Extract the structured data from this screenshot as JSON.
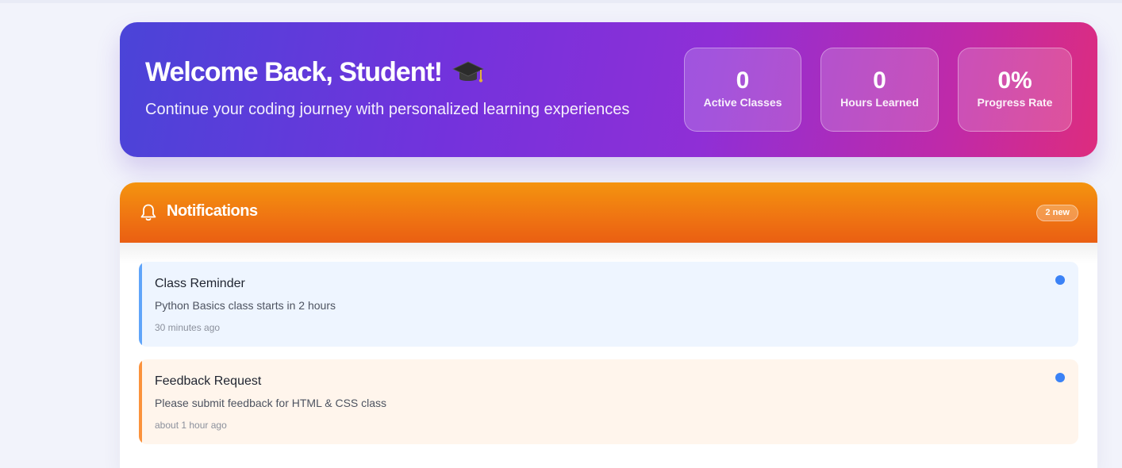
{
  "hero": {
    "title": "Welcome Back, Student!",
    "title_icon": "graduation-cap-icon",
    "subtitle": "Continue your coding journey with personalized learning experiences",
    "stats": [
      {
        "value": "0",
        "label": "Active Classes"
      },
      {
        "value": "0",
        "label": "Hours Learned"
      },
      {
        "value": "0%",
        "label": "Progress Rate"
      }
    ]
  },
  "notifications": {
    "icon": "bell-icon",
    "title": "Notifications",
    "badge": "2 new",
    "items": [
      {
        "title": "Class Reminder",
        "message": "Python Basics class starts in 2 hours",
        "time": "30 minutes ago",
        "accent": "#60a5fa",
        "background": "#eef5ff",
        "unread": true
      },
      {
        "title": "Feedback Request",
        "message": "Please submit feedback for HTML & CSS class",
        "time": "about 1 hour ago",
        "accent": "#fb923c",
        "background": "#fff5ec",
        "unread": true
      }
    ]
  },
  "colors": {
    "hero_gradient_start": "#4a44d8",
    "hero_gradient_end": "#dd2c7e",
    "notifications_header": "#f4940f",
    "unread_dot": "#3b82f6"
  }
}
